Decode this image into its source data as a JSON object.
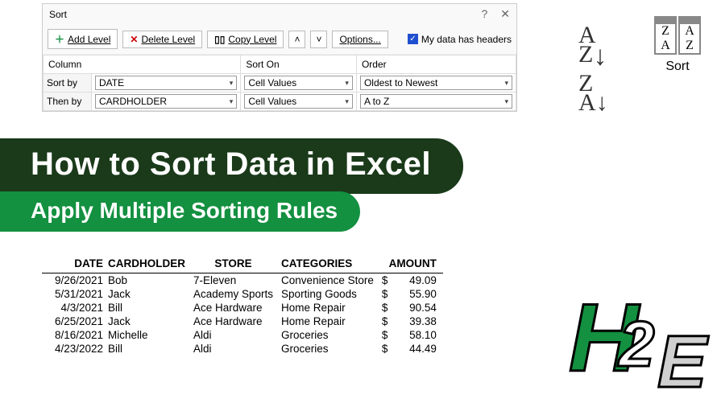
{
  "dialog": {
    "title": "Sort",
    "buttons": {
      "add": "Add Level",
      "delete": "Delete Level",
      "copy": "Copy Level",
      "options": "Options..."
    },
    "headers_checkbox": "My data has headers",
    "columns": {
      "col": "Column",
      "sorton": "Sort On",
      "order": "Order"
    },
    "rows": [
      {
        "label": "Sort by",
        "column": "DATE",
        "sorton": "Cell Values",
        "order": "Oldest to Newest"
      },
      {
        "label": "Then by",
        "column": "CARDHOLDER",
        "sorton": "Cell Values",
        "order": "A to Z"
      }
    ]
  },
  "ribbon": {
    "sort_label": "Sort"
  },
  "banner": {
    "top": "How to Sort Data in Excel",
    "sub": "Apply Multiple Sorting Rules"
  },
  "table": {
    "headers": [
      "DATE",
      "CARDHOLDER",
      "STORE",
      "CATEGORIES",
      "AMOUNT"
    ],
    "rows": [
      {
        "date": "9/26/2021",
        "holder": "Bob",
        "store": "7-Eleven",
        "cat": "Convenience Store",
        "amt": "49.09"
      },
      {
        "date": "5/31/2021",
        "holder": "Jack",
        "store": "Academy Sports",
        "cat": "Sporting Goods",
        "amt": "55.90"
      },
      {
        "date": "4/3/2021",
        "holder": "Bill",
        "store": "Ace Hardware",
        "cat": "Home Repair",
        "amt": "90.54"
      },
      {
        "date": "6/25/2021",
        "holder": "Jack",
        "store": "Ace Hardware",
        "cat": "Home Repair",
        "amt": "39.38"
      },
      {
        "date": "8/16/2021",
        "holder": "Michelle",
        "store": "Aldi",
        "cat": "Groceries",
        "amt": "58.10"
      },
      {
        "date": "4/23/2022",
        "holder": "Bill",
        "store": "Aldi",
        "cat": "Groceries",
        "amt": "44.49"
      }
    ]
  }
}
